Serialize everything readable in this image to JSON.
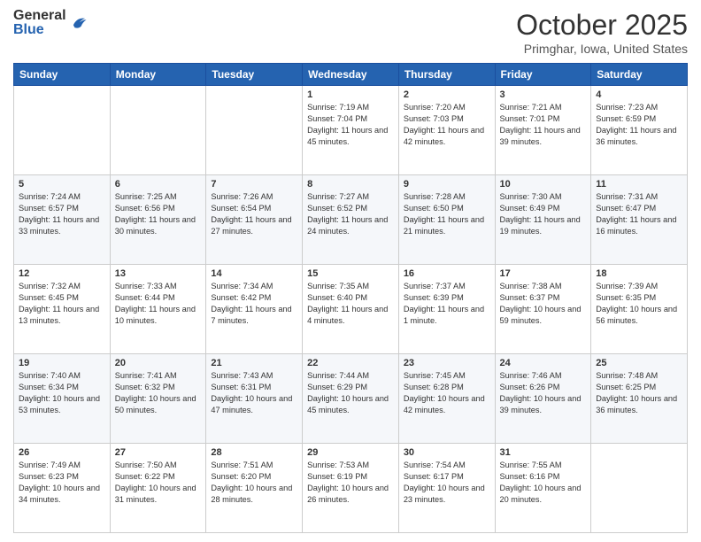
{
  "header": {
    "logo_general": "General",
    "logo_blue": "Blue",
    "month_title": "October 2025",
    "location": "Primghar, Iowa, United States"
  },
  "days_of_week": [
    "Sunday",
    "Monday",
    "Tuesday",
    "Wednesday",
    "Thursday",
    "Friday",
    "Saturday"
  ],
  "weeks": [
    [
      {
        "day": "",
        "sunrise": "",
        "sunset": "",
        "daylight": ""
      },
      {
        "day": "",
        "sunrise": "",
        "sunset": "",
        "daylight": ""
      },
      {
        "day": "",
        "sunrise": "",
        "sunset": "",
        "daylight": ""
      },
      {
        "day": "1",
        "sunrise": "Sunrise: 7:19 AM",
        "sunset": "Sunset: 7:04 PM",
        "daylight": "Daylight: 11 hours and 45 minutes."
      },
      {
        "day": "2",
        "sunrise": "Sunrise: 7:20 AM",
        "sunset": "Sunset: 7:03 PM",
        "daylight": "Daylight: 11 hours and 42 minutes."
      },
      {
        "day": "3",
        "sunrise": "Sunrise: 7:21 AM",
        "sunset": "Sunset: 7:01 PM",
        "daylight": "Daylight: 11 hours and 39 minutes."
      },
      {
        "day": "4",
        "sunrise": "Sunrise: 7:23 AM",
        "sunset": "Sunset: 6:59 PM",
        "daylight": "Daylight: 11 hours and 36 minutes."
      }
    ],
    [
      {
        "day": "5",
        "sunrise": "Sunrise: 7:24 AM",
        "sunset": "Sunset: 6:57 PM",
        "daylight": "Daylight: 11 hours and 33 minutes."
      },
      {
        "day": "6",
        "sunrise": "Sunrise: 7:25 AM",
        "sunset": "Sunset: 6:56 PM",
        "daylight": "Daylight: 11 hours and 30 minutes."
      },
      {
        "day": "7",
        "sunrise": "Sunrise: 7:26 AM",
        "sunset": "Sunset: 6:54 PM",
        "daylight": "Daylight: 11 hours and 27 minutes."
      },
      {
        "day": "8",
        "sunrise": "Sunrise: 7:27 AM",
        "sunset": "Sunset: 6:52 PM",
        "daylight": "Daylight: 11 hours and 24 minutes."
      },
      {
        "day": "9",
        "sunrise": "Sunrise: 7:28 AM",
        "sunset": "Sunset: 6:50 PM",
        "daylight": "Daylight: 11 hours and 21 minutes."
      },
      {
        "day": "10",
        "sunrise": "Sunrise: 7:30 AM",
        "sunset": "Sunset: 6:49 PM",
        "daylight": "Daylight: 11 hours and 19 minutes."
      },
      {
        "day": "11",
        "sunrise": "Sunrise: 7:31 AM",
        "sunset": "Sunset: 6:47 PM",
        "daylight": "Daylight: 11 hours and 16 minutes."
      }
    ],
    [
      {
        "day": "12",
        "sunrise": "Sunrise: 7:32 AM",
        "sunset": "Sunset: 6:45 PM",
        "daylight": "Daylight: 11 hours and 13 minutes."
      },
      {
        "day": "13",
        "sunrise": "Sunrise: 7:33 AM",
        "sunset": "Sunset: 6:44 PM",
        "daylight": "Daylight: 11 hours and 10 minutes."
      },
      {
        "day": "14",
        "sunrise": "Sunrise: 7:34 AM",
        "sunset": "Sunset: 6:42 PM",
        "daylight": "Daylight: 11 hours and 7 minutes."
      },
      {
        "day": "15",
        "sunrise": "Sunrise: 7:35 AM",
        "sunset": "Sunset: 6:40 PM",
        "daylight": "Daylight: 11 hours and 4 minutes."
      },
      {
        "day": "16",
        "sunrise": "Sunrise: 7:37 AM",
        "sunset": "Sunset: 6:39 PM",
        "daylight": "Daylight: 11 hours and 1 minute."
      },
      {
        "day": "17",
        "sunrise": "Sunrise: 7:38 AM",
        "sunset": "Sunset: 6:37 PM",
        "daylight": "Daylight: 10 hours and 59 minutes."
      },
      {
        "day": "18",
        "sunrise": "Sunrise: 7:39 AM",
        "sunset": "Sunset: 6:35 PM",
        "daylight": "Daylight: 10 hours and 56 minutes."
      }
    ],
    [
      {
        "day": "19",
        "sunrise": "Sunrise: 7:40 AM",
        "sunset": "Sunset: 6:34 PM",
        "daylight": "Daylight: 10 hours and 53 minutes."
      },
      {
        "day": "20",
        "sunrise": "Sunrise: 7:41 AM",
        "sunset": "Sunset: 6:32 PM",
        "daylight": "Daylight: 10 hours and 50 minutes."
      },
      {
        "day": "21",
        "sunrise": "Sunrise: 7:43 AM",
        "sunset": "Sunset: 6:31 PM",
        "daylight": "Daylight: 10 hours and 47 minutes."
      },
      {
        "day": "22",
        "sunrise": "Sunrise: 7:44 AM",
        "sunset": "Sunset: 6:29 PM",
        "daylight": "Daylight: 10 hours and 45 minutes."
      },
      {
        "day": "23",
        "sunrise": "Sunrise: 7:45 AM",
        "sunset": "Sunset: 6:28 PM",
        "daylight": "Daylight: 10 hours and 42 minutes."
      },
      {
        "day": "24",
        "sunrise": "Sunrise: 7:46 AM",
        "sunset": "Sunset: 6:26 PM",
        "daylight": "Daylight: 10 hours and 39 minutes."
      },
      {
        "day": "25",
        "sunrise": "Sunrise: 7:48 AM",
        "sunset": "Sunset: 6:25 PM",
        "daylight": "Daylight: 10 hours and 36 minutes."
      }
    ],
    [
      {
        "day": "26",
        "sunrise": "Sunrise: 7:49 AM",
        "sunset": "Sunset: 6:23 PM",
        "daylight": "Daylight: 10 hours and 34 minutes."
      },
      {
        "day": "27",
        "sunrise": "Sunrise: 7:50 AM",
        "sunset": "Sunset: 6:22 PM",
        "daylight": "Daylight: 10 hours and 31 minutes."
      },
      {
        "day": "28",
        "sunrise": "Sunrise: 7:51 AM",
        "sunset": "Sunset: 6:20 PM",
        "daylight": "Daylight: 10 hours and 28 minutes."
      },
      {
        "day": "29",
        "sunrise": "Sunrise: 7:53 AM",
        "sunset": "Sunset: 6:19 PM",
        "daylight": "Daylight: 10 hours and 26 minutes."
      },
      {
        "day": "30",
        "sunrise": "Sunrise: 7:54 AM",
        "sunset": "Sunset: 6:17 PM",
        "daylight": "Daylight: 10 hours and 23 minutes."
      },
      {
        "day": "31",
        "sunrise": "Sunrise: 7:55 AM",
        "sunset": "Sunset: 6:16 PM",
        "daylight": "Daylight: 10 hours and 20 minutes."
      },
      {
        "day": "",
        "sunrise": "",
        "sunset": "",
        "daylight": ""
      }
    ]
  ]
}
